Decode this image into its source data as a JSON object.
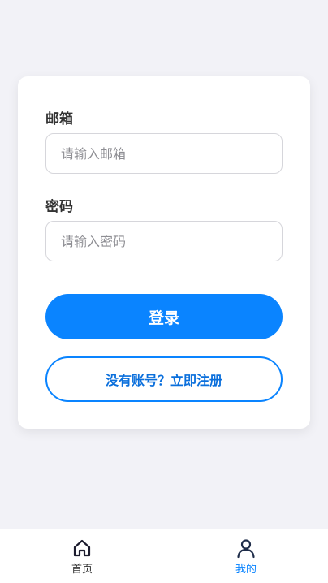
{
  "login_form": {
    "email_label": "邮箱",
    "email_placeholder": "请输入邮箱",
    "password_label": "密码",
    "password_placeholder": "请输入密码",
    "login_button": "登录",
    "register_button": "没有账号？立即注册"
  },
  "tabbar": {
    "items": [
      {
        "label": "首页",
        "icon": "home-icon",
        "active": false
      },
      {
        "label": "我的",
        "icon": "user-icon",
        "active": true
      }
    ]
  },
  "colors": {
    "background": "#f2f2f7",
    "accent": "#0a84ff",
    "card": "#ffffff"
  }
}
